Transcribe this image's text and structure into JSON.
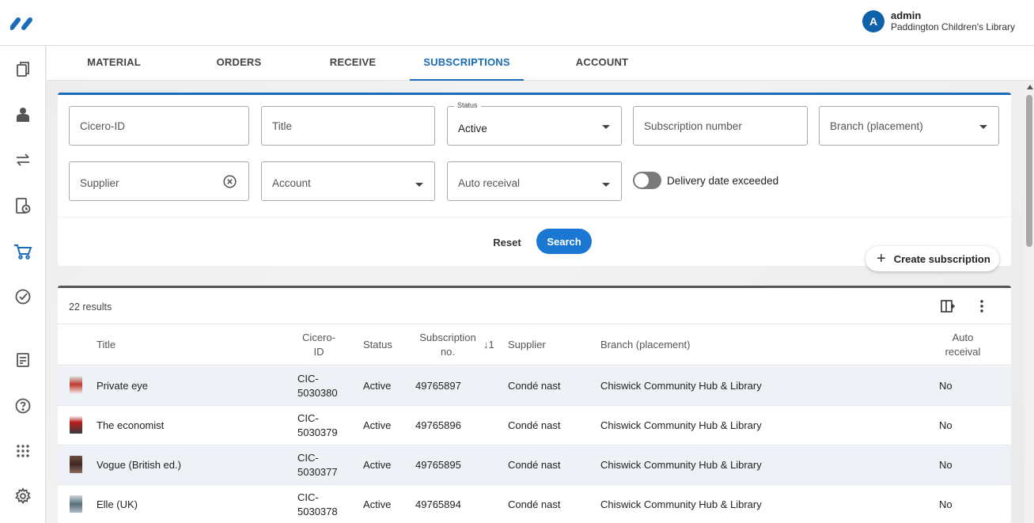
{
  "user": {
    "initial": "A",
    "name": "admin",
    "library": "Paddington Children's Library"
  },
  "sidebar": [
    "catalogue-icon",
    "patrons-icon",
    "circulation-icon",
    "periodicals-icon",
    "acquisitions-cart-icon",
    "tasks-check-icon",
    "reports-icon",
    "help-icon",
    "apps-grid-icon",
    "settings-icon"
  ],
  "tabs": [
    {
      "label": "MATERIAL SELECTION"
    },
    {
      "label": "ORDERS"
    },
    {
      "label": "RECEIVE"
    },
    {
      "label": "SUBSCRIPTIONS",
      "active": true
    },
    {
      "label": "ACCOUNT TRANSACTIONS"
    }
  ],
  "filters": {
    "cicero_id": {
      "placeholder": "Cicero-ID"
    },
    "title": {
      "placeholder": "Title"
    },
    "status": {
      "label": "Status",
      "value": "Active"
    },
    "subscription_number": {
      "placeholder": "Subscription number"
    },
    "branch": {
      "placeholder": "Branch (placement)"
    },
    "supplier": {
      "placeholder": "Supplier"
    },
    "account": {
      "placeholder": "Account"
    },
    "auto_receival": {
      "placeholder": "Auto receival"
    },
    "delivery_toggle": {
      "label": "Delivery date exceeded",
      "on": false
    },
    "reset_label": "Reset",
    "search_label": "Search"
  },
  "create_subscription": {
    "plus": "+",
    "label": "Create subscription"
  },
  "results": {
    "count": "22 results",
    "headers": {
      "title": "Title",
      "cicero_id": [
        "Cicero-",
        "ID"
      ],
      "status": "Status",
      "subscription_no": [
        "Subscription",
        "no."
      ],
      "sort": "↓1",
      "supplier": "Supplier",
      "branch": "Branch (placement)",
      "auto_receival": [
        "Auto",
        "receival"
      ]
    },
    "rows": [
      {
        "title": "Private eye",
        "cicero_id": [
          "CIC-",
          "5030380"
        ],
        "status": "Active",
        "subscription_no": "49765897",
        "supplier": "Condé nast",
        "branch": "Chiswick Community Hub & Library",
        "auto_receival": "No"
      },
      {
        "title": "The economist",
        "cicero_id": [
          "CIC-",
          "5030379"
        ],
        "status": "Active",
        "subscription_no": "49765896",
        "supplier": "Condé nast",
        "branch": "Chiswick Community Hub & Library",
        "auto_receival": "No"
      },
      {
        "title": "Vogue (British ed.)",
        "cicero_id": [
          "CIC-",
          "5030377"
        ],
        "status": "Active",
        "subscription_no": "49765895",
        "supplier": "Condé nast",
        "branch": "Chiswick Community Hub & Library",
        "auto_receival": "No"
      },
      {
        "title": "Elle (UK)",
        "cicero_id": [
          "CIC-",
          "5030378"
        ],
        "status": "Active",
        "subscription_no": "49765894",
        "supplier": "Condé nast",
        "branch": "Chiswick Community Hub & Library",
        "auto_receival": "No"
      }
    ]
  },
  "colors": {
    "accent": "#1a6bb8",
    "button": "#1a78d2",
    "avatar": "#0d62a8"
  }
}
